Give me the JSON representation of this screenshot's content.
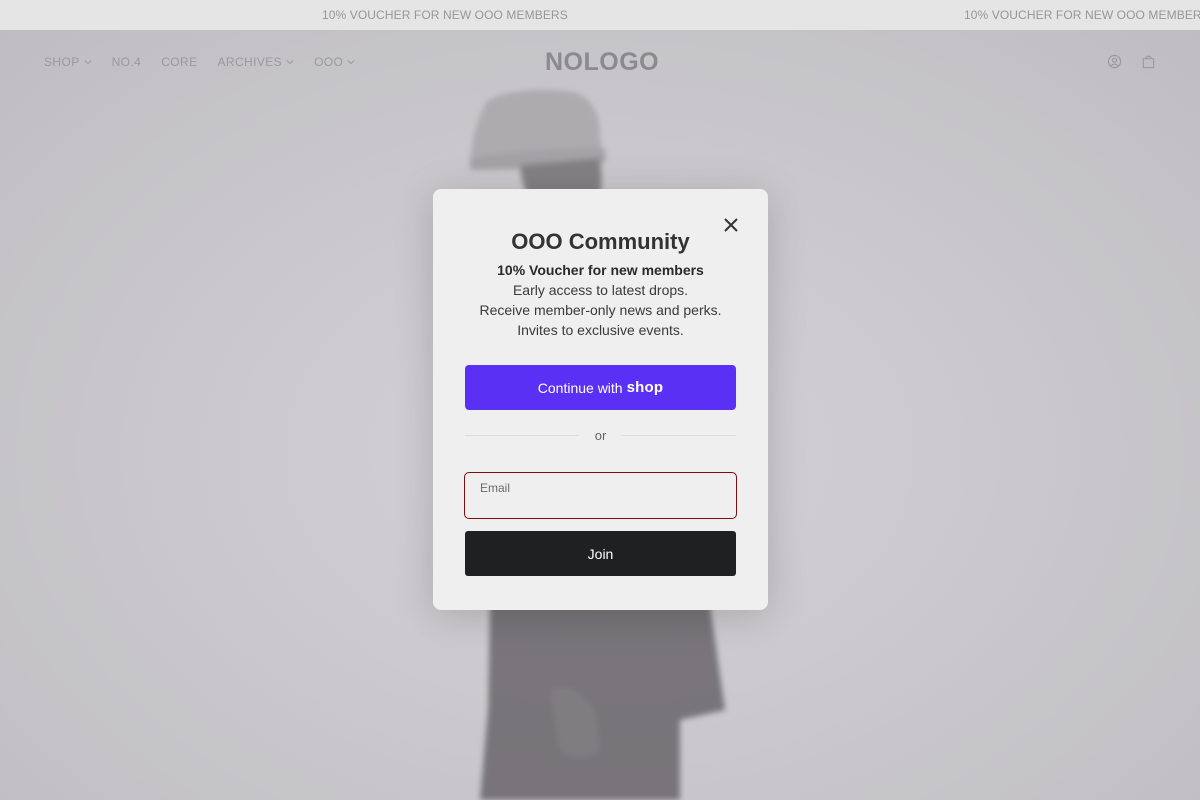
{
  "announcement": {
    "text": "10% VOUCHER FOR NEW OOO MEMBERS"
  },
  "header": {
    "nav": [
      {
        "label": "SHOP",
        "has_dropdown": true
      },
      {
        "label": "NO.4",
        "has_dropdown": false
      },
      {
        "label": "CORE",
        "has_dropdown": false
      },
      {
        "label": "ARCHIVES",
        "has_dropdown": true
      },
      {
        "label": "OOO",
        "has_dropdown": true
      }
    ],
    "logo": "NOLOGO",
    "icons": [
      "account-icon",
      "bag-icon"
    ]
  },
  "modal": {
    "title": "OOO Community",
    "subtitle": "10% Voucher for new members",
    "lines": [
      "Early access to latest drops.",
      "Receive member-only news and perks.",
      "Invites to exclusive events."
    ],
    "shop_button": {
      "prefix": "Continue with",
      "brand": "shop"
    },
    "divider": "or",
    "email": {
      "label": "Email",
      "value": "",
      "placeholder": ""
    },
    "join_label": "Join"
  },
  "colors": {
    "shop_purple": "#5a31f4",
    "join_dark": "#1f2022",
    "email_border": "#7a0e0e",
    "modal_bg": "#efefef"
  }
}
